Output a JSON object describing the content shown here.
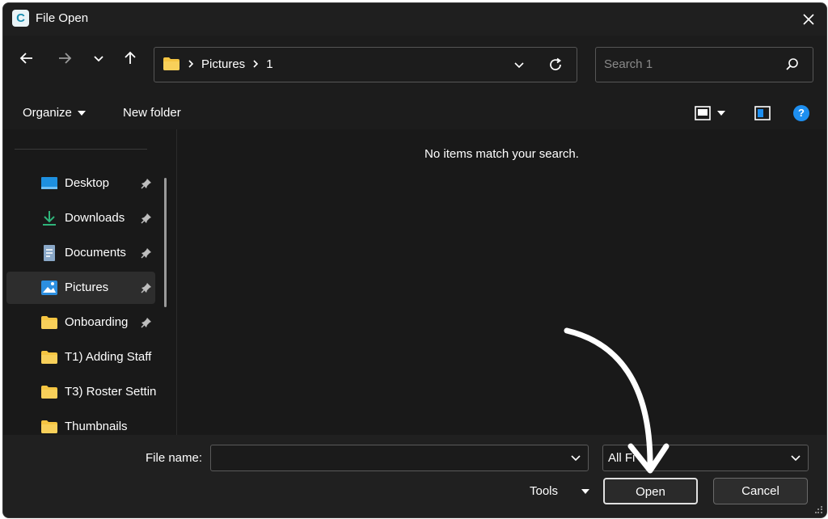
{
  "window": {
    "title": "File Open",
    "app_icon_letter": "C"
  },
  "nav": {
    "back_icon": "arrow-left-icon",
    "forward_icon": "arrow-right-icon",
    "recent_icon": "chevron-down-icon",
    "up_icon": "arrow-up-icon",
    "breadcrumb": [
      "Pictures",
      "1"
    ],
    "search_placeholder": "Search 1"
  },
  "commands": {
    "organize": "Organize",
    "new_folder": "New folder"
  },
  "sidebar": {
    "items": [
      {
        "label": "Desktop",
        "icon": "desktop-icon",
        "pinned": true
      },
      {
        "label": "Downloads",
        "icon": "download-icon",
        "pinned": true
      },
      {
        "label": "Documents",
        "icon": "document-icon",
        "pinned": true
      },
      {
        "label": "Pictures",
        "icon": "pictures-icon",
        "pinned": true,
        "selected": true
      },
      {
        "label": "Onboarding",
        "icon": "folder-icon",
        "pinned": true
      },
      {
        "label": "T1) Adding Staff",
        "icon": "folder-icon",
        "pinned": false
      },
      {
        "label": "T3) Roster Settin",
        "icon": "folder-icon",
        "pinned": false
      },
      {
        "label": "Thumbnails",
        "icon": "folder-icon",
        "pinned": false
      }
    ]
  },
  "content": {
    "empty_message": "No items match your search."
  },
  "footer": {
    "file_name_label": "File name:",
    "file_name_value": "",
    "file_type_value": "All Fi",
    "tools_label": "Tools",
    "open_label": "Open",
    "cancel_label": "Cancel"
  },
  "colors": {
    "background": "#191919",
    "accent": "#1e8ff0",
    "folder": "#f5c542"
  }
}
